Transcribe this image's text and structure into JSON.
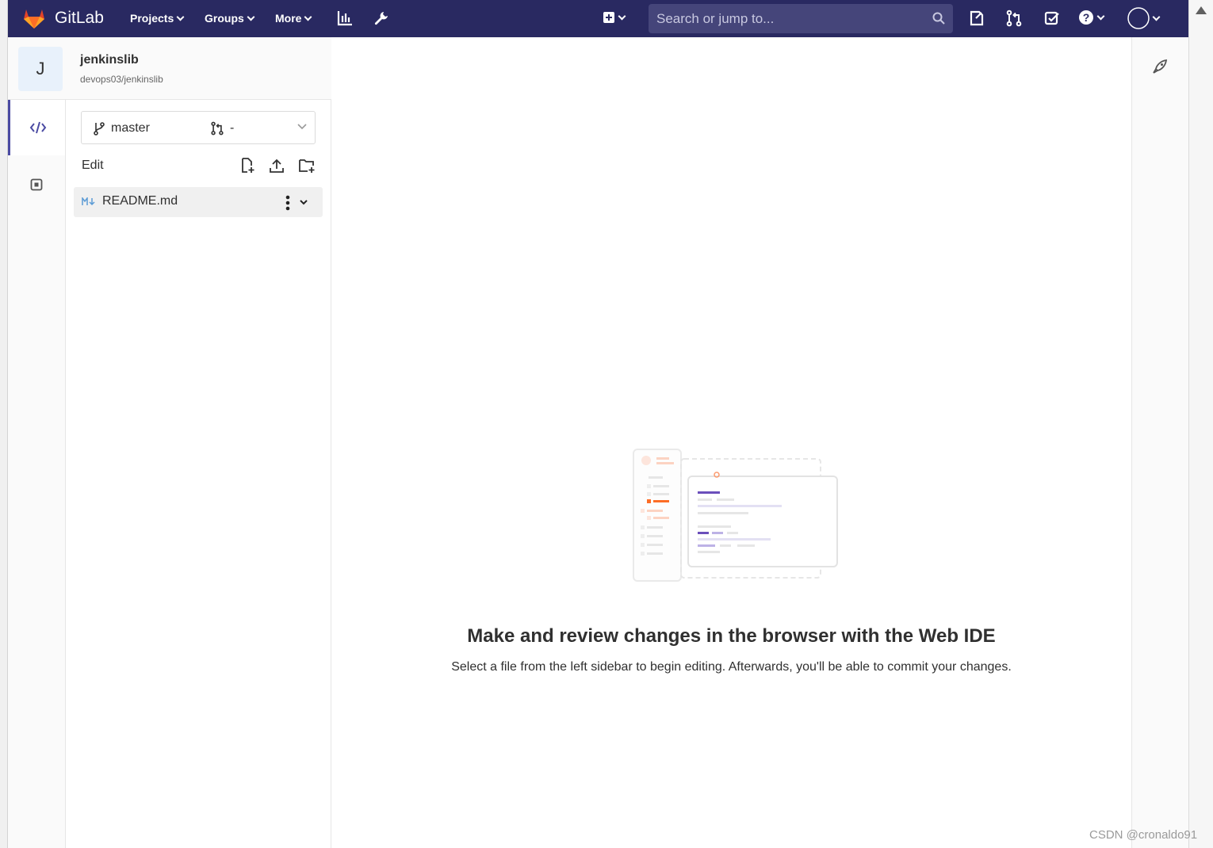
{
  "navbar": {
    "brand": "GitLab",
    "menu": [
      {
        "label": "Projects"
      },
      {
        "label": "Groups"
      },
      {
        "label": "More"
      }
    ],
    "search_placeholder": "Search or jump to..."
  },
  "project": {
    "avatar_letter": "J",
    "name": "jenkinslib",
    "path": "devops03/jenkinslib"
  },
  "branch": {
    "name": "master",
    "merge_request": "-"
  },
  "file_tree": {
    "edit_label": "Edit",
    "files": [
      {
        "name": "README.md",
        "type": "markdown"
      }
    ]
  },
  "empty_state": {
    "title": "Make and review changes in the browser with the Web IDE",
    "description": "Select a file from the left sidebar to begin editing. Afterwards, you'll be able to commit your changes."
  },
  "watermark": "CSDN @cronaldo91",
  "colors": {
    "navbar": "#292961",
    "accent": "#4b4ba3",
    "logo_orange": "#fc6d26"
  }
}
